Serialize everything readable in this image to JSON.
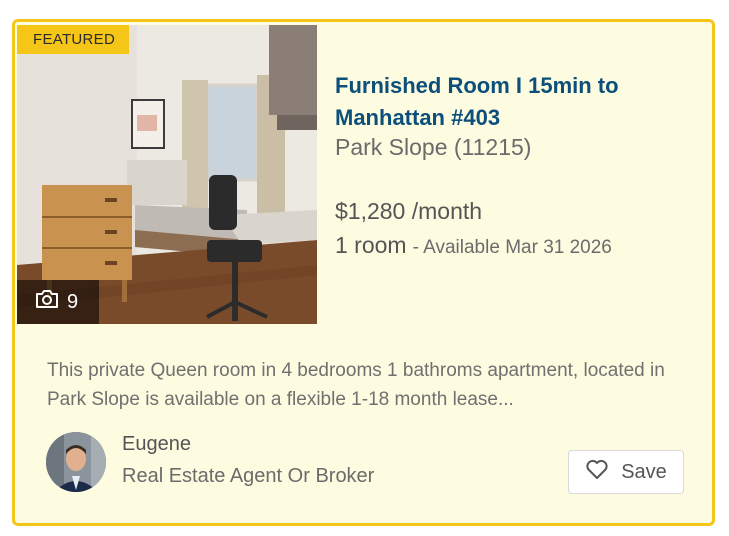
{
  "listing": {
    "badge": "FEATURED",
    "photo_count": "9",
    "title": "Furnished Room I 15min to Manhattan #403",
    "neighborhood": "Park Slope (11215)",
    "price": "$1,280 /month",
    "rooms": "1 room",
    "availability": "- Available Mar 31 2026",
    "description": "This private Queen room in 4 bedrooms 1 bathroms apartment, located in Park Slope is available on a flexible 1-18 month lease..."
  },
  "agent": {
    "name": "Eugene",
    "role": "Real Estate Agent Or Broker"
  },
  "actions": {
    "save_label": "Save"
  },
  "colors": {
    "accent": "#f5c518",
    "card_background": "#fdfbe0",
    "title": "#0b4f7a"
  },
  "icons": [
    "camera-icon",
    "heart-icon"
  ]
}
